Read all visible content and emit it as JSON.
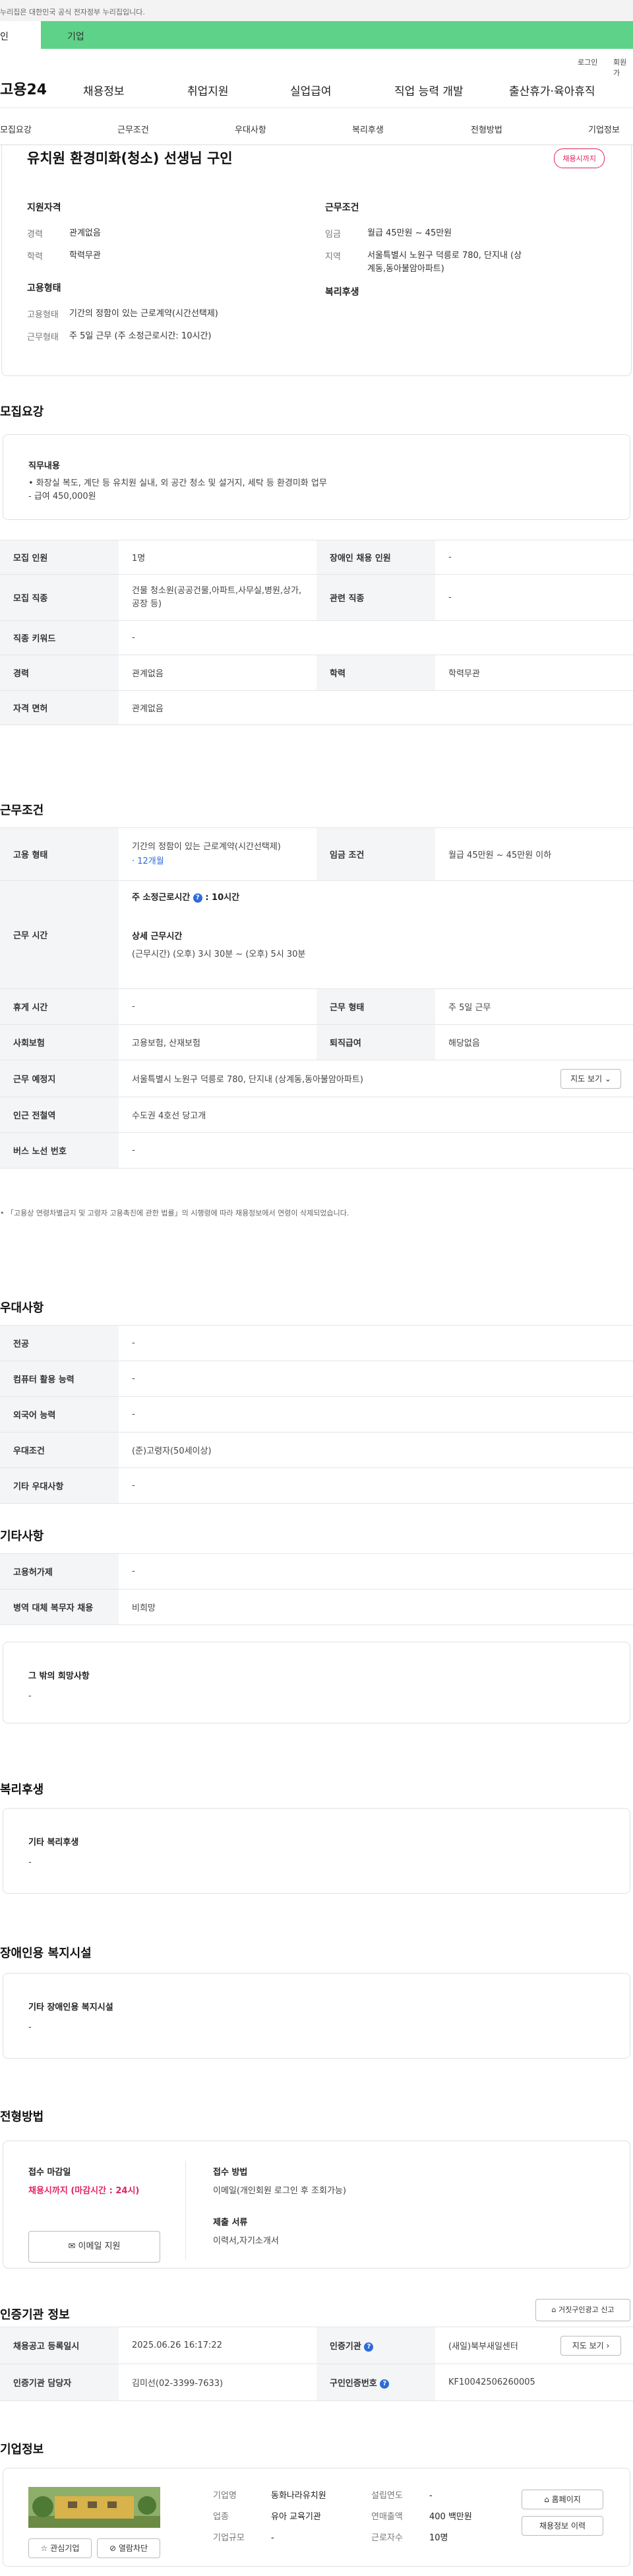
{
  "top_notice": "누리집은 대한민국 공식 전자정부 누리집입니다.",
  "audience_tabs": [
    "인",
    "기업"
  ],
  "util_links": [
    "로그인",
    "회원가"
  ],
  "gnb": {
    "logo": "고용24",
    "menu": [
      "채용정보",
      "취업지원",
      "실업급여",
      "직업 능력 개발",
      "출산휴가·육아휴직"
    ]
  },
  "subnav": [
    "모집요강",
    "근무조건",
    "우대사항",
    "복리후생",
    "전형방법",
    "기업정보"
  ],
  "job": {
    "title": "유치원 환경미화(청소) 선생님 구인",
    "status_badge": "채용시까지",
    "qual_title": "지원자격",
    "career_label": "경력",
    "career": "관계없음",
    "edu_label": "학력",
    "edu": "학력무관",
    "emp_title": "고용형태",
    "emp_type_label": "고용형태",
    "emp_type": "기간의 정함이 있는 근로계약(시간선택제)",
    "work_form_label": "근무형태",
    "work_form": "주 5일 근무 (주 소정근로시간: 10시간)",
    "cond_title": "근무조건",
    "wage_label": "임금",
    "wage": "월급 45만원 ~ 45만원",
    "area_label": "지역",
    "area": "서울특별시 노원구 덕릉로 780, 단지내 (상계동,동아불암아파트)",
    "welfare_title": "복리후생"
  },
  "recruit": {
    "section_title": "모집요강",
    "duty_title": "직무내용",
    "duty_lines": [
      "• 화장실 복도,  계단 등 유치원 실내, 외 공간 청소 및 설거지, 세탁 등 환경미화 업무",
      "- 급여 450,000원"
    ],
    "rows": [
      {
        "k1": "모집 인원",
        "v1": "1명",
        "k2": "장애인 채용 인원",
        "v2": "-"
      },
      {
        "k1": "모집 직종",
        "v1": "건물 청소원(공공건물,아파트,사무실,병원,상가,공장 등)",
        "k2": "관련 직종",
        "v2": "-"
      },
      {
        "k1": "직종 키워드",
        "v1": "-"
      },
      {
        "k1": "경력",
        "v1": "관계없음",
        "k2": "학력",
        "v2": "학력무관"
      },
      {
        "k1": "자격 면허",
        "v1": "관계없음"
      }
    ]
  },
  "work": {
    "section_title": "근무조건",
    "emp_type_label": "고용 형태",
    "emp_type": "기간의 정함이 있는 근로계약(시간선택제)",
    "emp_period": "· 12개월",
    "wage_label": "임금 조건",
    "wage": "월급 45만원 ~ 45만원 이하",
    "hours_label": "근무 시간",
    "weekly_label": "주 소정근로시간",
    "weekly_value": ": 10시간",
    "detail_label": "상세 근무시간",
    "detail_value": "(근무시간) (오후) 3시 30분 ~ (오후) 5시 30분",
    "rows": [
      {
        "k1": "휴게 시간",
        "v1": "-",
        "k2": "근무 형태",
        "v2": "주 5일 근무"
      },
      {
        "k1": "사회보험",
        "v1": "고용보험, 산재보험",
        "k2": "퇴직급여",
        "v2": "해당없음"
      }
    ],
    "place_label": "근무 예정지",
    "place": "서울특별시 노원구 덕릉로 780, 단지내 (상계동,동아불암아파트)",
    "map_btn": "지도 보기",
    "station_label": "인근 전철역",
    "station": "수도권 4호선 당고개",
    "bus_label": "버스 노선 번호",
    "bus": "-",
    "notice": "「고용상 연령차별금지 및 고령자 고용촉진에 관한 법률」의 시행령에 따라 채용정보에서 연령이 삭제되었습니다."
  },
  "pref": {
    "section_title": "우대사항",
    "rows": [
      {
        "k": "전공",
        "v": "-"
      },
      {
        "k": "컴퓨터 활용 능력",
        "v": "-"
      },
      {
        "k": "외국어 능력",
        "v": "-"
      },
      {
        "k": "우대조건",
        "v": "(준)고령자(50세이상)"
      },
      {
        "k": "기타 우대사항",
        "v": "-"
      }
    ]
  },
  "etc": {
    "section_title": "기타사항",
    "rows": [
      {
        "k": "고용허가제",
        "v": "-"
      },
      {
        "k": "병역 대체 복무자 채용",
        "v": "비희망"
      }
    ],
    "other_title": "그 밖의 희망사항",
    "other_value": "-"
  },
  "welfare": {
    "section_title": "복리후생",
    "box_title": "기타 복리후생",
    "box_value": "-"
  },
  "disabled": {
    "section_title": "장애인용 복지시설",
    "box_title": "기타 장애인용 복지시설",
    "box_value": "-"
  },
  "selection": {
    "section_title": "전형방법",
    "deadline_title": "접수 마감일",
    "deadline_value": "채용시까지 (마감시간 : 24시)",
    "email_btn": "이메일 지원",
    "method_title": "접수 방법",
    "method_value": "이메일(개인회원 로그인 후 조회가능)",
    "docs_title": "제출 서류",
    "docs_value": "이력서,자기소개서"
  },
  "cert": {
    "section_title": "인증기관 정보",
    "report_btn": "거짓구인광고 신고",
    "date_label": "채용공고 등록일시",
    "date_value": "2025.06.26 16:17:22",
    "org_label": "인증기관",
    "org_value": "(새일)북부새일센터",
    "map_btn": "지도 보기",
    "manager_label": "인증기관 담당자",
    "manager_value": "김미선(02-3399-7633)",
    "no_label": "구인인증번호",
    "no_value": "KF10042506260005"
  },
  "company": {
    "section_title": "기업정보",
    "name_label": "기업명",
    "name": "동화나라유치원",
    "founded_label": "설립연도",
    "founded": "-",
    "industry_label": "업종",
    "industry": "유아 교육기관",
    "revenue_label": "연매출액",
    "revenue": "400 백만원",
    "size_label": "기업규모",
    "size": "-",
    "staff_label": "근로자수",
    "staff": "10명",
    "home_btn": "홈페이지",
    "history_btn": "채용정보 이력",
    "fav_btn": "관심기업",
    "block_btn": "열람차단"
  },
  "colors": {
    "green": "#5ed288",
    "red": "#e0245e",
    "blue": "#2f6bd8"
  }
}
